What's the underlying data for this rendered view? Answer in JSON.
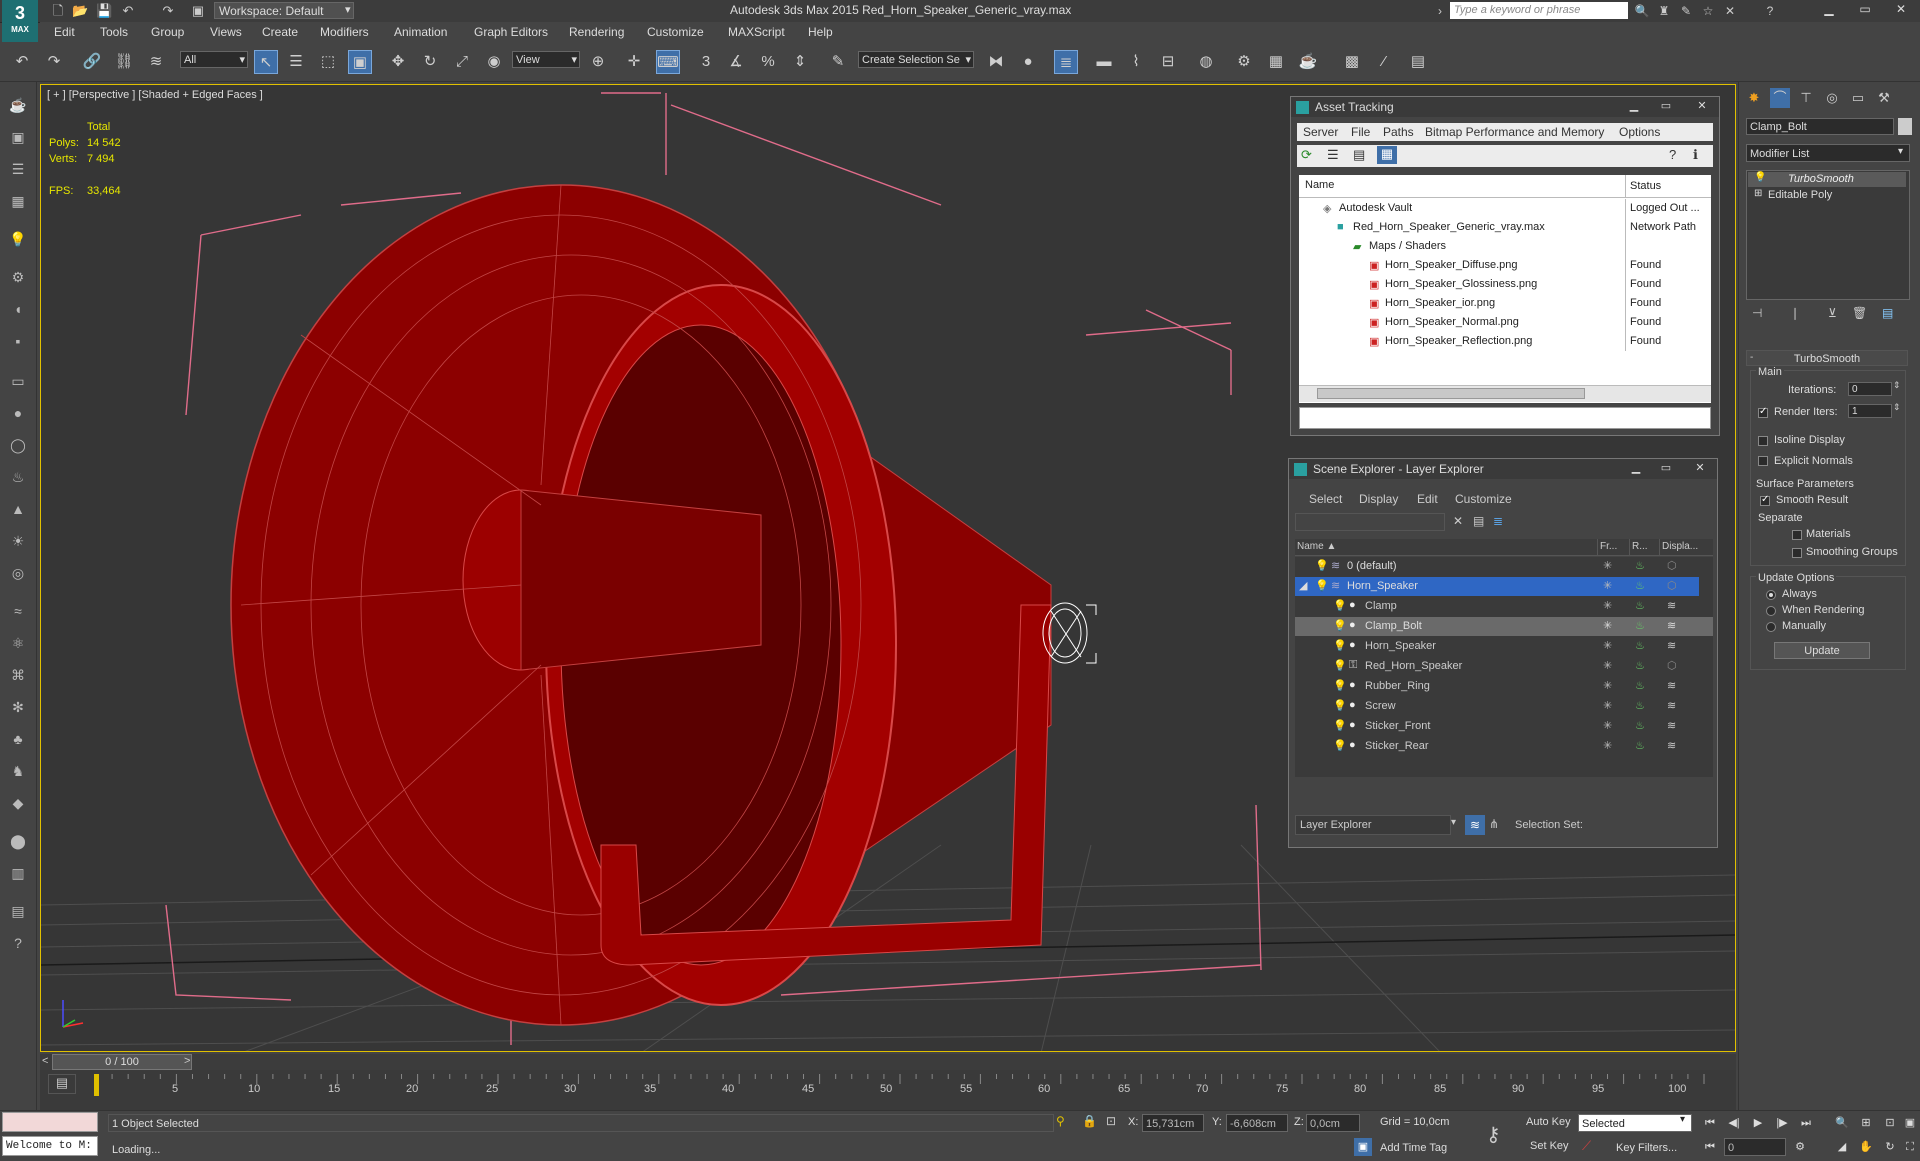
{
  "title_bar": {
    "app_logo": "3",
    "app_logo_sub": "MAX",
    "workspace": "Workspace: Default",
    "window_title": "Autodesk 3ds Max  2015    Red_Horn_Speaker_Generic_vray.max",
    "search_placeholder": "Type a keyword or phrase"
  },
  "menus": [
    "Edit",
    "Tools",
    "Group",
    "Views",
    "Create",
    "Modifiers",
    "Animation",
    "Graph Editors",
    "Rendering",
    "Customize",
    "MAXScript",
    "Help"
  ],
  "toolbar": {
    "selection_filter": "All",
    "ref_coord": "View",
    "named_selection_placeholder": "Create Selection Se",
    "snap_labels": [
      "3",
      "%",
      "⁺"
    ]
  },
  "viewport": {
    "label": "[ + ] [Perspective ] [Shaded + Edged Faces ]",
    "stats": {
      "total_label": "Total",
      "polys_label": "Polys:",
      "polys_value": "14 542",
      "verts_label": "Verts:",
      "verts_value": "7 494",
      "fps_label": "FPS:",
      "fps_value": "33,464"
    },
    "colors": {
      "model": "#a30000",
      "wire": "#d84848",
      "bbox": "#e06c8a",
      "grid": "#555555"
    }
  },
  "asset_tracking": {
    "title": "Asset Tracking",
    "menus": [
      "Server",
      "File",
      "Paths",
      "Bitmap Performance and Memory",
      "Options"
    ],
    "columns": {
      "name": "Name",
      "status": "Status"
    },
    "rows": [
      {
        "name": "Autodesk Vault",
        "status": "Logged Out ..."
      },
      {
        "name": "Red_Horn_Speaker_Generic_vray.max",
        "status": "Network Path"
      },
      {
        "name": "Maps / Shaders",
        "status": ""
      },
      {
        "name": "Horn_Speaker_Diffuse.png",
        "status": "Found"
      },
      {
        "name": "Horn_Speaker_Glossiness.png",
        "status": "Found"
      },
      {
        "name": "Horn_Speaker_ior.png",
        "status": "Found"
      },
      {
        "name": "Horn_Speaker_Normal.png",
        "status": "Found"
      },
      {
        "name": "Horn_Speaker_Reflection.png",
        "status": "Found"
      }
    ]
  },
  "scene_explorer": {
    "title": "Scene Explorer - Layer Explorer",
    "menus": [
      "Select",
      "Display",
      "Edit",
      "Customize"
    ],
    "columns": {
      "name": "Name ▲",
      "fr": "Fr...",
      "r": "R...",
      "disp": "Displa..."
    },
    "rows": [
      {
        "name": "0 (default)",
        "indent": 0
      },
      {
        "name": "Horn_Speaker",
        "indent": 0
      },
      {
        "name": "Clamp",
        "indent": 1
      },
      {
        "name": "Clamp_Bolt",
        "indent": 1
      },
      {
        "name": "Horn_Speaker",
        "indent": 1
      },
      {
        "name": "Red_Horn_Speaker",
        "indent": 1
      },
      {
        "name": "Rubber_Ring",
        "indent": 1
      },
      {
        "name": "Screw",
        "indent": 1
      },
      {
        "name": "Sticker_Front",
        "indent": 1
      },
      {
        "name": "Sticker_Rear",
        "indent": 1
      }
    ],
    "footer_dropdown": "Layer Explorer",
    "selection_set_label": "Selection Set:"
  },
  "command_panel": {
    "object_name": "Clamp_Bolt",
    "modifier_list": "Modifier List",
    "stack": [
      "TurboSmooth",
      "Editable Poly"
    ],
    "turbosmooth": {
      "header": "TurboSmooth",
      "main": "Main",
      "iterations_label": "Iterations:",
      "iterations_value": "0",
      "render_iters_label": "Render Iters:",
      "render_iters_value": "1",
      "isoline": "Isoline Display",
      "explicit_normals": "Explicit Normals",
      "surface_params": "Surface Parameters",
      "smooth_result": "Smooth Result",
      "separate": "Separate",
      "materials": "Materials",
      "smoothing_groups": "Smoothing Groups",
      "update_options": "Update Options",
      "always": "Always",
      "when_rendering": "When Rendering",
      "manually": "Manually",
      "update_button": "Update"
    }
  },
  "timeline": {
    "frame_display": "0 / 100",
    "ticks": [
      "5",
      "10",
      "15",
      "20",
      "25",
      "30",
      "35",
      "40",
      "45",
      "50",
      "55",
      "60",
      "65",
      "70",
      "75",
      "80",
      "85",
      "90",
      "95",
      "100"
    ]
  },
  "status_bar": {
    "maxscript": "Welcome to M:",
    "selected": "1 Object Selected",
    "loading": "Loading...",
    "x_label": "X:",
    "x_value": "15,731cm",
    "y_label": "Y:",
    "y_value": "-6,608cm",
    "z_label": "Z:",
    "z_value": "0,0cm",
    "grid": "Grid = 10,0cm",
    "add_time_tag": "Add Time Tag",
    "auto_key": "Auto Key",
    "set_key": "Set Key",
    "selected_dropdown": "Selected",
    "key_filters": "Key Filters...",
    "frame_value": "0"
  }
}
